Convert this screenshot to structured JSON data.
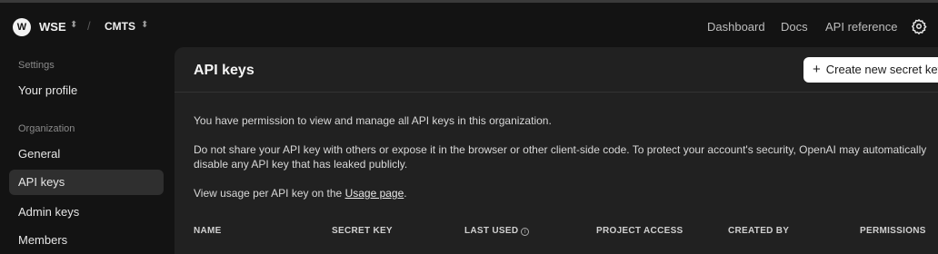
{
  "topbar": {
    "org_initial": "W",
    "org_name": "WSE",
    "separator": "/",
    "project_name": "CMTS",
    "links": {
      "dashboard": "Dashboard",
      "docs": "Docs",
      "api_reference": "API reference"
    }
  },
  "sidebar": {
    "settings_heading": "Settings",
    "your_profile": "Your profile",
    "organization_heading": "Organization",
    "items": [
      {
        "label": "General",
        "active": false
      },
      {
        "label": "API keys",
        "active": true
      },
      {
        "label": "Admin keys",
        "active": false
      },
      {
        "label": "Members",
        "active": false
      }
    ]
  },
  "main": {
    "title": "API keys",
    "create_button": "Create new secret key",
    "permission_text": "You have permission to view and manage all API keys in this organization.",
    "warning_line1": "Do not share your API key with others or expose it in the browser or other client-side code. To protect your account's security, OpenAI may automatically",
    "warning_line2": "disable any API key that has leaked publicly.",
    "usage_prefix": "View usage per API key on the ",
    "usage_link": "Usage page",
    "usage_suffix": ".",
    "columns": {
      "name": "NAME",
      "secret_key": "SECRET KEY",
      "last_used": "LAST USED",
      "project_access": "PROJECT ACCESS",
      "created_by": "CREATED BY",
      "permissions": "PERMISSIONS"
    }
  },
  "icons": {
    "org_chevron": "chevron-updown-icon",
    "project_chevron": "chevron-updown-icon",
    "settings": "gear-icon",
    "plus": "plus-icon",
    "info": "info-icon"
  },
  "colors": {
    "background": "#131313",
    "panel": "#212121",
    "active_item": "#2f2f2f",
    "button_bg": "#ffffff"
  }
}
